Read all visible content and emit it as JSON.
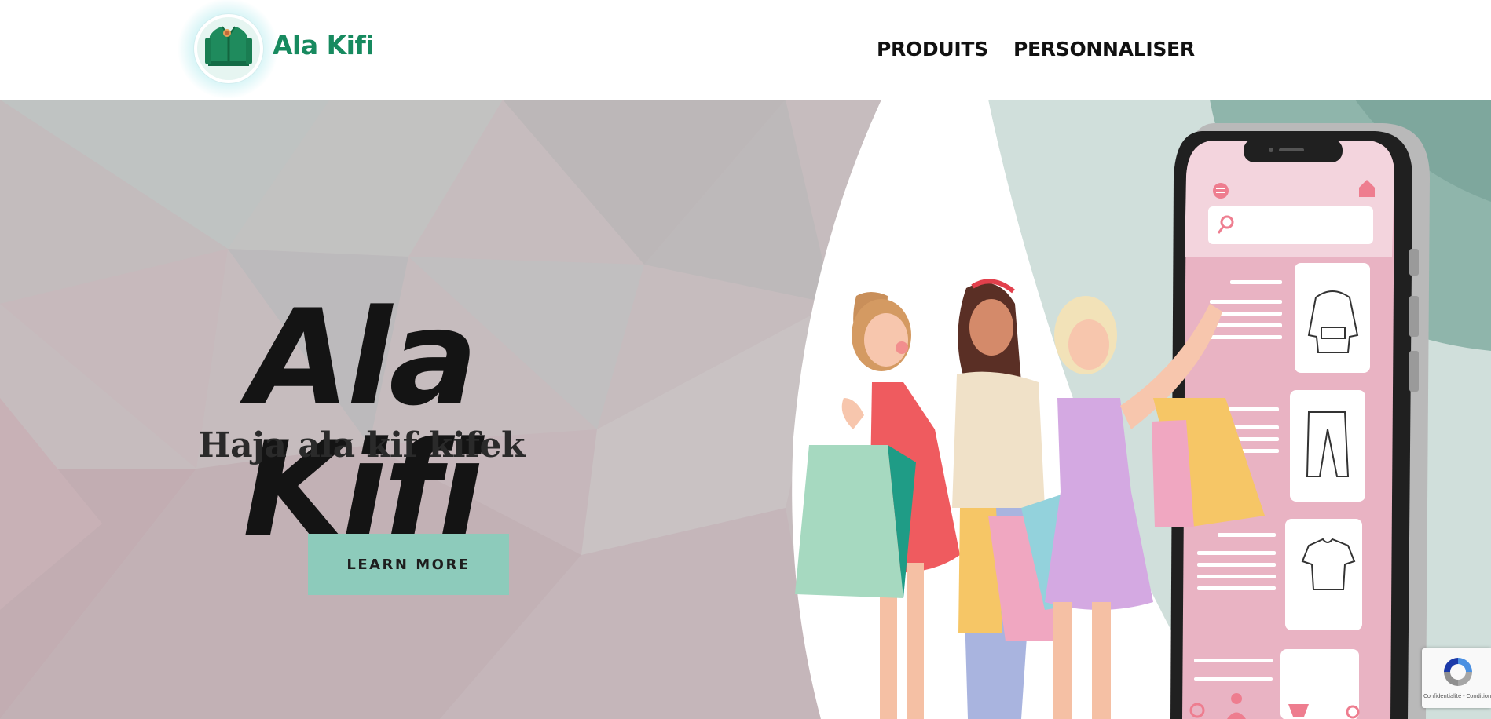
{
  "header": {
    "brand_name": "Ala Kifi",
    "nav": [
      {
        "label": "PRODUITS"
      },
      {
        "label": "PERSONNALISER"
      }
    ]
  },
  "hero": {
    "title": "Ala Kifi",
    "subtitle": "Haja ala kif kifek",
    "cta_label": "LEARN MORE"
  },
  "recaptcha": {
    "links": "Confidentialité - Conditions"
  },
  "colors": {
    "brand_green": "#178a5f",
    "cta_bg": "#8dcbbb",
    "hero_bg": "#c6bcbe",
    "phone_screen": "#e8b5c4"
  },
  "icons": [
    "hoodie-logo-icon",
    "search-icon",
    "home-icon",
    "menu-icon",
    "cart-icon",
    "user-icon",
    "recaptcha-icon"
  ]
}
